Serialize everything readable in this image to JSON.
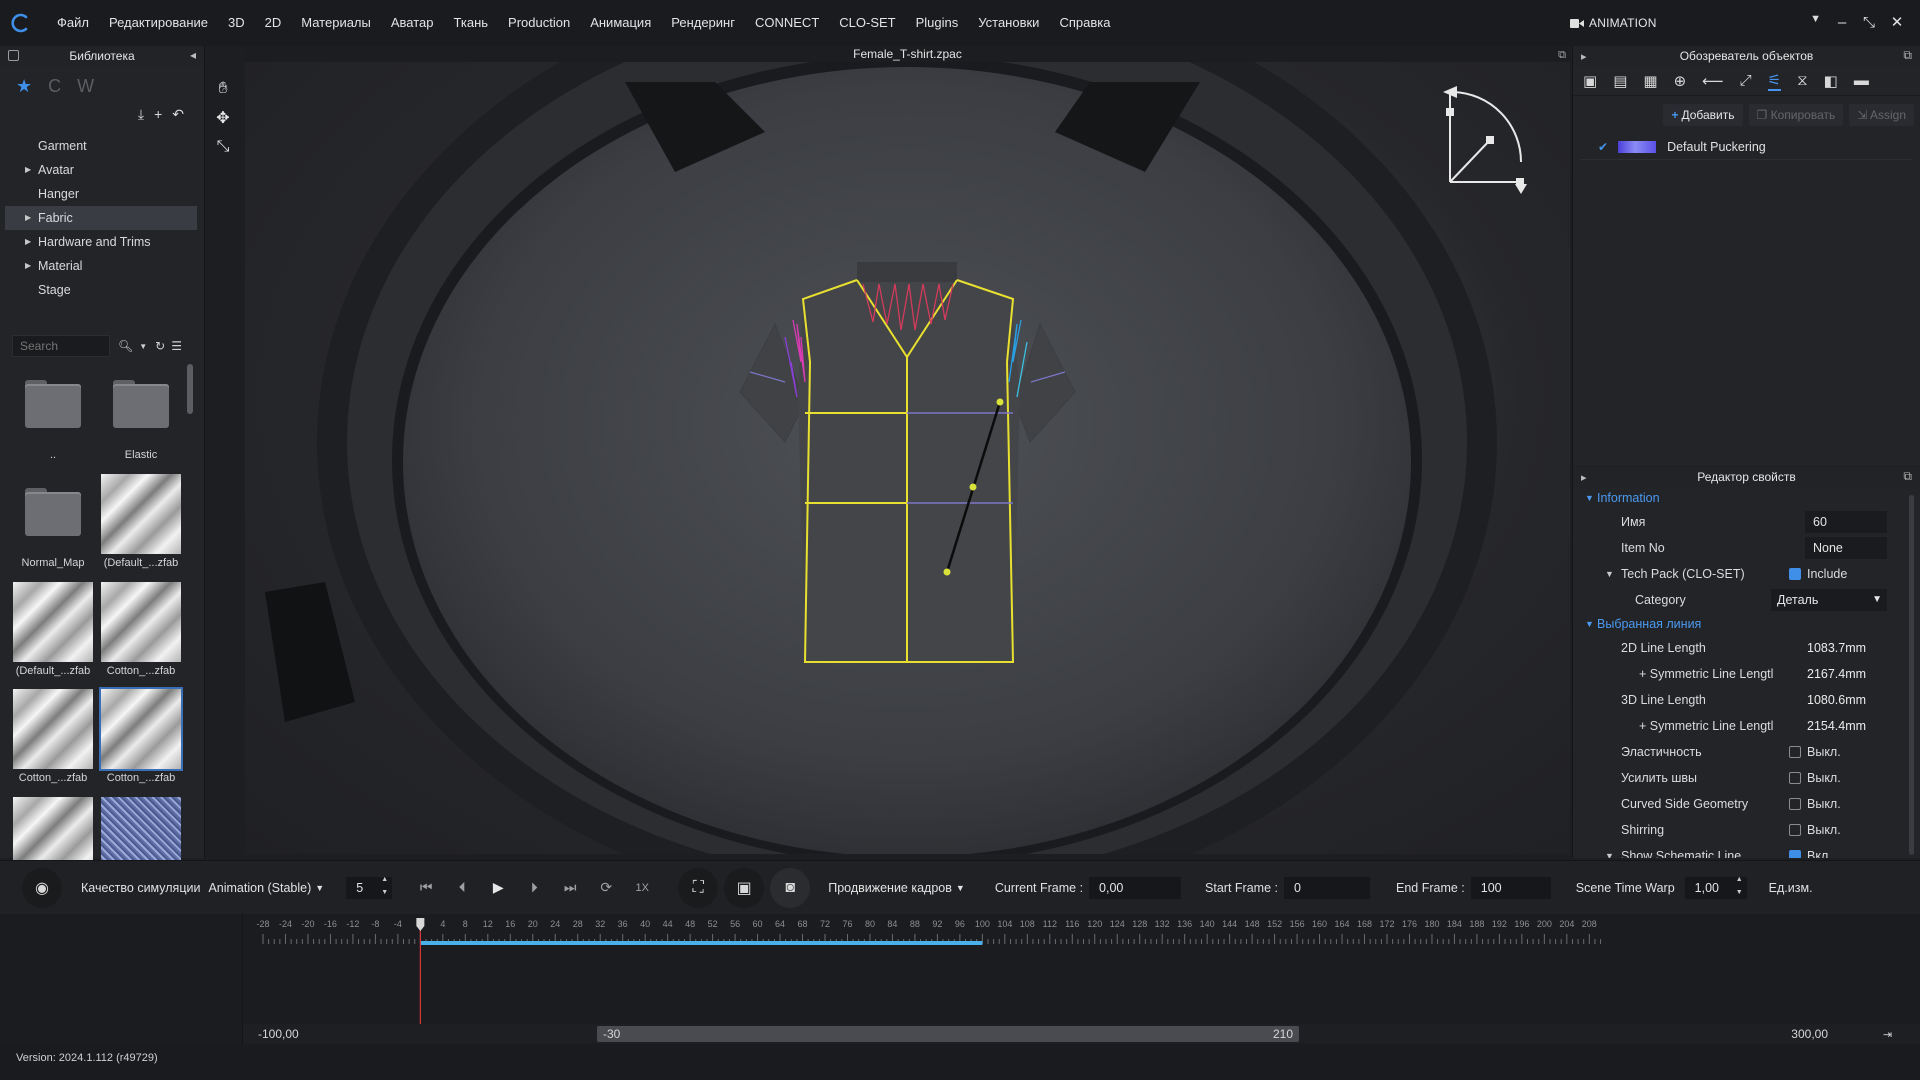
{
  "menubar": {
    "items": [
      "Файл",
      "Редактирование",
      "3D",
      "2D",
      "Материалы",
      "Аватар",
      "Ткань",
      "Production",
      "Анимация",
      "Рендеринг",
      "CONNECT",
      "CLO-SET",
      "Plugins",
      "Установки",
      "Справка"
    ],
    "mode": "ANIMATION"
  },
  "library": {
    "title": "Библиотека",
    "tree": [
      {
        "label": "Garment",
        "expandable": false
      },
      {
        "label": "Avatar",
        "expandable": true
      },
      {
        "label": "Hanger",
        "expandable": false
      },
      {
        "label": "Fabric",
        "expandable": true,
        "selected": true
      },
      {
        "label": "Hardware and Trims",
        "expandable": true
      },
      {
        "label": "Material",
        "expandable": true
      },
      {
        "label": "Stage",
        "expandable": false
      }
    ],
    "search_placeholder": "Search",
    "tiles": [
      {
        "caption": "..",
        "kind": "folder"
      },
      {
        "caption": "Elastic",
        "kind": "folder"
      },
      {
        "caption": "Normal_Map",
        "kind": "folder"
      },
      {
        "caption": "(Default_...zfab",
        "kind": "fabric"
      },
      {
        "caption": "(Default_...zfab",
        "kind": "fabric"
      },
      {
        "caption": "Cotton_...zfab",
        "kind": "fabric"
      },
      {
        "caption": "Cotton_...zfab",
        "kind": "fabric"
      },
      {
        "caption": "Cotton_...zfab",
        "kind": "fabric",
        "selected": true
      },
      {
        "caption": "",
        "kind": "fabric"
      },
      {
        "caption": "",
        "kind": "denim"
      }
    ]
  },
  "viewport": {
    "title": "Female_T-shirt.zpac"
  },
  "object_browser": {
    "title": "Обозреватель объектов",
    "add_label": "Добавить",
    "copy_label": "Копировать",
    "assign_label": "Assign",
    "item_label": "Default Puckering"
  },
  "property_editor": {
    "title": "Редактор свойств",
    "information_label": "Information",
    "name_label": "Имя",
    "name_value": "60",
    "itemno_label": "Item No",
    "itemno_value": "None",
    "techpack_label": "Tech Pack (CLO-SET)",
    "include_label": "Include",
    "category_label": "Category",
    "category_value": "Деталь",
    "selected_line_label": "Выбранная линия",
    "line2d_label": "2D Line Length",
    "line2d_value": "1083.7mm",
    "sym1_label": "+ Symmetric Line Lengtl",
    "sym1_value": "2167.4mm",
    "line3d_label": "3D Line Length",
    "line3d_value": "1080.6mm",
    "sym2_label": "+ Symmetric Line Lengtl",
    "sym2_value": "2154.4mm",
    "elasticity_label": "Эластичность",
    "elasticity_value": "Выкл.",
    "strengthen_label": "Усилить швы",
    "strengthen_value": "Выкл.",
    "curved_label": "Curved Side Geometry",
    "curved_value": "Выкл.",
    "shirring_label": "Shirring",
    "shirring_value": "Выкл.",
    "schematic_label": "Show Schematic Line",
    "schematic_value": "Вкл."
  },
  "animation_bar": {
    "quality_label": "Качество симуляции",
    "quality_value": "Animation (Stable)",
    "step_value": "5",
    "speed_label": "1X",
    "frame_advance_label": "Продвижение кадров",
    "current_frame_label": "Current Frame :",
    "current_frame_value": "0,00",
    "start_frame_label": "Start Frame :",
    "start_frame_value": "0",
    "end_frame_label": "End Frame :",
    "end_frame_value": "100",
    "time_warp_label": "Scene Time Warp",
    "time_warp_value": "1,00",
    "units_label": "Ед.изм."
  },
  "timeline": {
    "ticks": [
      "-28",
      "-24",
      "-20",
      "-16",
      "-12",
      "-8",
      "-4",
      "0",
      "4",
      "8",
      "12",
      "16",
      "20",
      "24",
      "28",
      "32",
      "36",
      "40",
      "44",
      "48",
      "52",
      "56",
      "60",
      "64",
      "68",
      "72",
      "76",
      "80",
      "84",
      "88",
      "92",
      "96",
      "100",
      "104",
      "108",
      "112",
      "116",
      "120",
      "124",
      "128",
      "132",
      "136",
      "140",
      "144",
      "148",
      "152",
      "156",
      "160",
      "164",
      "168",
      "172",
      "176",
      "180",
      "184",
      "188",
      "192",
      "196",
      "200",
      "204",
      "208"
    ],
    "range_start": 0,
    "range_end": 100,
    "playhead": 0,
    "left_value": "-100,00",
    "right_value": "300,00",
    "scroll_left": "-30",
    "scroll_right": "210"
  },
  "status": {
    "version": "Version: 2024.1.112 (r49729)"
  },
  "colors": {
    "accent": "#3f8ee8",
    "seam_yellow": "#e8e030",
    "timeline_bar": "#4ab0ea",
    "playhead": "#d83a3a"
  }
}
